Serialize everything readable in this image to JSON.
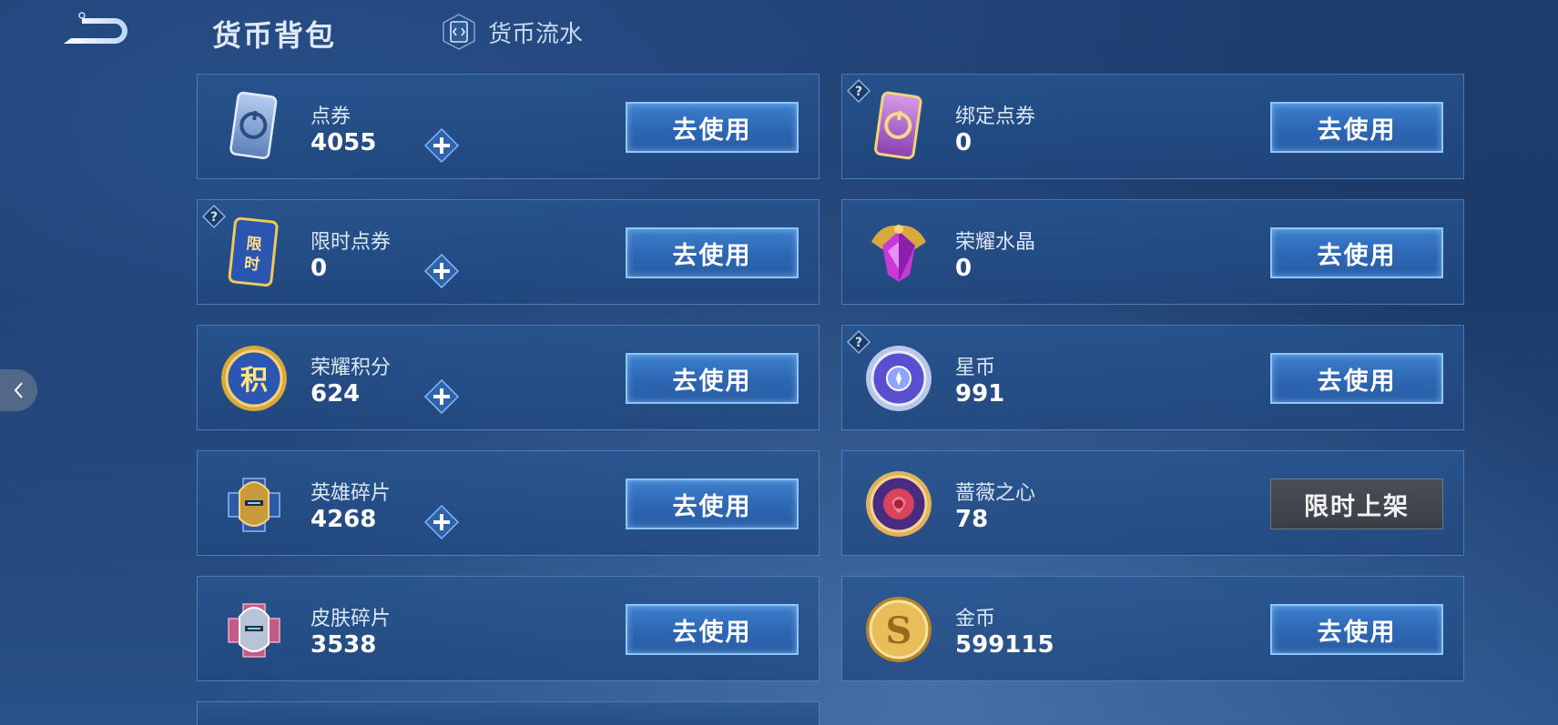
{
  "header": {
    "title": "货币背包",
    "flow_label": "货币流水"
  },
  "currencies": [
    {
      "name": "点券",
      "amount": "4055",
      "button": "去使用",
      "icon": "coupon-blue-icon",
      "has_plus": true,
      "has_help": false
    },
    {
      "name": "绑定点券",
      "amount": "0",
      "button": "去使用",
      "icon": "coupon-purple-icon",
      "has_plus": false,
      "has_help": true
    },
    {
      "name": "限时点券",
      "amount": "0",
      "button": "去使用",
      "icon": "limited-coupon-icon",
      "has_plus": true,
      "has_help": true
    },
    {
      "name": "荣耀水晶",
      "amount": "0",
      "button": "去使用",
      "icon": "glory-crystal-icon",
      "has_plus": true,
      "has_help": false
    },
    {
      "name": "荣耀积分",
      "amount": "624",
      "button": "去使用",
      "icon": "glory-points-icon",
      "has_plus": true,
      "has_help": false
    },
    {
      "name": "星币",
      "amount": "991",
      "button": "去使用",
      "icon": "star-coin-icon",
      "has_plus": true,
      "has_help": true
    },
    {
      "name": "英雄碎片",
      "amount": "4268",
      "button": "去使用",
      "icon": "hero-fragment-icon",
      "has_plus": false,
      "has_help": false
    },
    {
      "name": "蔷薇之心",
      "amount": "78",
      "button": "限时上架",
      "icon": "rose-heart-icon",
      "has_plus": true,
      "has_help": false
    },
    {
      "name": "皮肤碎片",
      "amount": "3538",
      "button": "去使用",
      "icon": "skin-fragment-icon",
      "has_plus": false,
      "has_help": false
    },
    {
      "name": "金币",
      "amount": "599115",
      "button": "去使用",
      "icon": "gold-coin-icon",
      "has_plus": false,
      "has_help": false
    }
  ],
  "colors": {
    "accent": "#8cc6ff",
    "button_blue": "#2d66b3",
    "button_gray": "#3a3e45"
  }
}
